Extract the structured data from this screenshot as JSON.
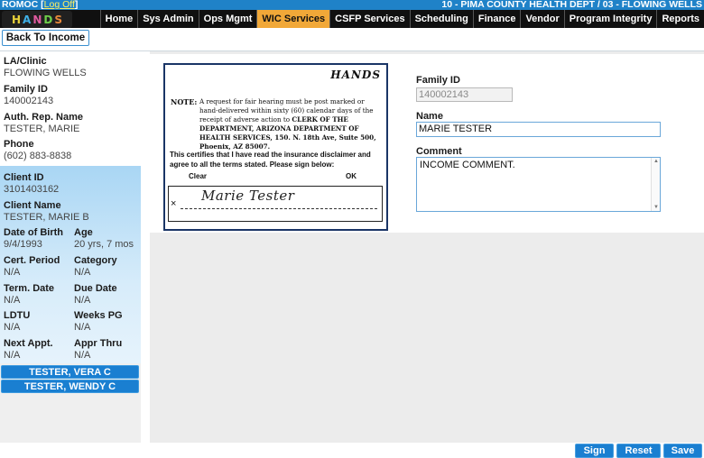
{
  "topbar": {
    "user": "ROMOC",
    "logoff": "Log Off",
    "clinic": "10 - PIMA COUNTY HEALTH DEPT / 03 - FLOWING WELLS"
  },
  "logo": {
    "letters": [
      "H",
      "A",
      "N",
      "D",
      "S"
    ],
    "colors": [
      "#e8d23a",
      "#3fb0e8",
      "#e05aa0",
      "#6fcf4a",
      "#e8893a"
    ]
  },
  "nav": [
    {
      "label": "Home"
    },
    {
      "label": "Sys Admin"
    },
    {
      "label": "Ops Mgmt"
    },
    {
      "label": "WIC Services",
      "active": true
    },
    {
      "label": "CSFP Services"
    },
    {
      "label": "Scheduling"
    },
    {
      "label": "Finance"
    },
    {
      "label": "Vendor"
    },
    {
      "label": "Program Integrity"
    },
    {
      "label": "Reports"
    }
  ],
  "back_button": "Back To Income",
  "family": {
    "la_clinic_label": "LA/Clinic",
    "la_clinic": "FLOWING WELLS",
    "family_id_label": "Family ID",
    "family_id": "140002143",
    "auth_rep_label": "Auth. Rep. Name",
    "auth_rep": "TESTER, MARIE",
    "phone_label": "Phone",
    "phone": "(602) 883-8838"
  },
  "client": {
    "client_id_label": "Client ID",
    "client_id": "3101403162",
    "client_name_label": "Client Name",
    "client_name": "TESTER, MARIE B",
    "dob_label": "Date of Birth",
    "dob": "9/4/1993",
    "age_label": "Age",
    "age": "20 yrs, 7 mos",
    "cert_period_label": "Cert. Period",
    "cert_period": "N/A",
    "category_label": "Category",
    "category": "N/A",
    "term_date_label": "Term. Date",
    "term_date": "N/A",
    "due_date_label": "Due Date",
    "due_date": "N/A",
    "ldtu_label": "LDTU",
    "ldtu": "N/A",
    "weeks_pg_label": "Weeks PG",
    "weeks_pg": "N/A",
    "next_appt_label": "Next Appt.",
    "next_appt": "N/A",
    "appr_thru_label": "Appr Thru",
    "appr_thru": "N/A"
  },
  "household": [
    "TESTER, VERA C",
    "TESTER, WENDY C"
  ],
  "signature_card": {
    "logo": "HANDS",
    "note_label": "NOTE:",
    "note_pre": "A request for fair hearing must be post marked or hand-delivered within sixty (60) calendar days of the receipt of adverse action to ",
    "note_bold": "CLERK OF THE DEPARTMENT, ARIZONA DEPARTMENT OF HEALTH SERVICES, 150. N. 18th Ave, Suite 500, Phoenix, AZ 85007.",
    "certify": "This certifies that I have read the insurance disclaimer and agree to all the terms stated.  Please sign below:",
    "clear": "Clear",
    "ok": "OK",
    "x_mark": "×",
    "signature": "Marie Tester"
  },
  "form": {
    "family_id_label": "Family ID",
    "family_id": "140002143",
    "name_label": "Name",
    "name": "MARIE TESTER",
    "comment_label": "Comment",
    "comment": "INCOME COMMENT."
  },
  "buttons": {
    "sign": "Sign",
    "reset": "Reset",
    "save": "Save"
  },
  "colors": {
    "accent": "#1a7fd1",
    "nav_active": "#f1a838",
    "topbar": "#1f82c8"
  }
}
